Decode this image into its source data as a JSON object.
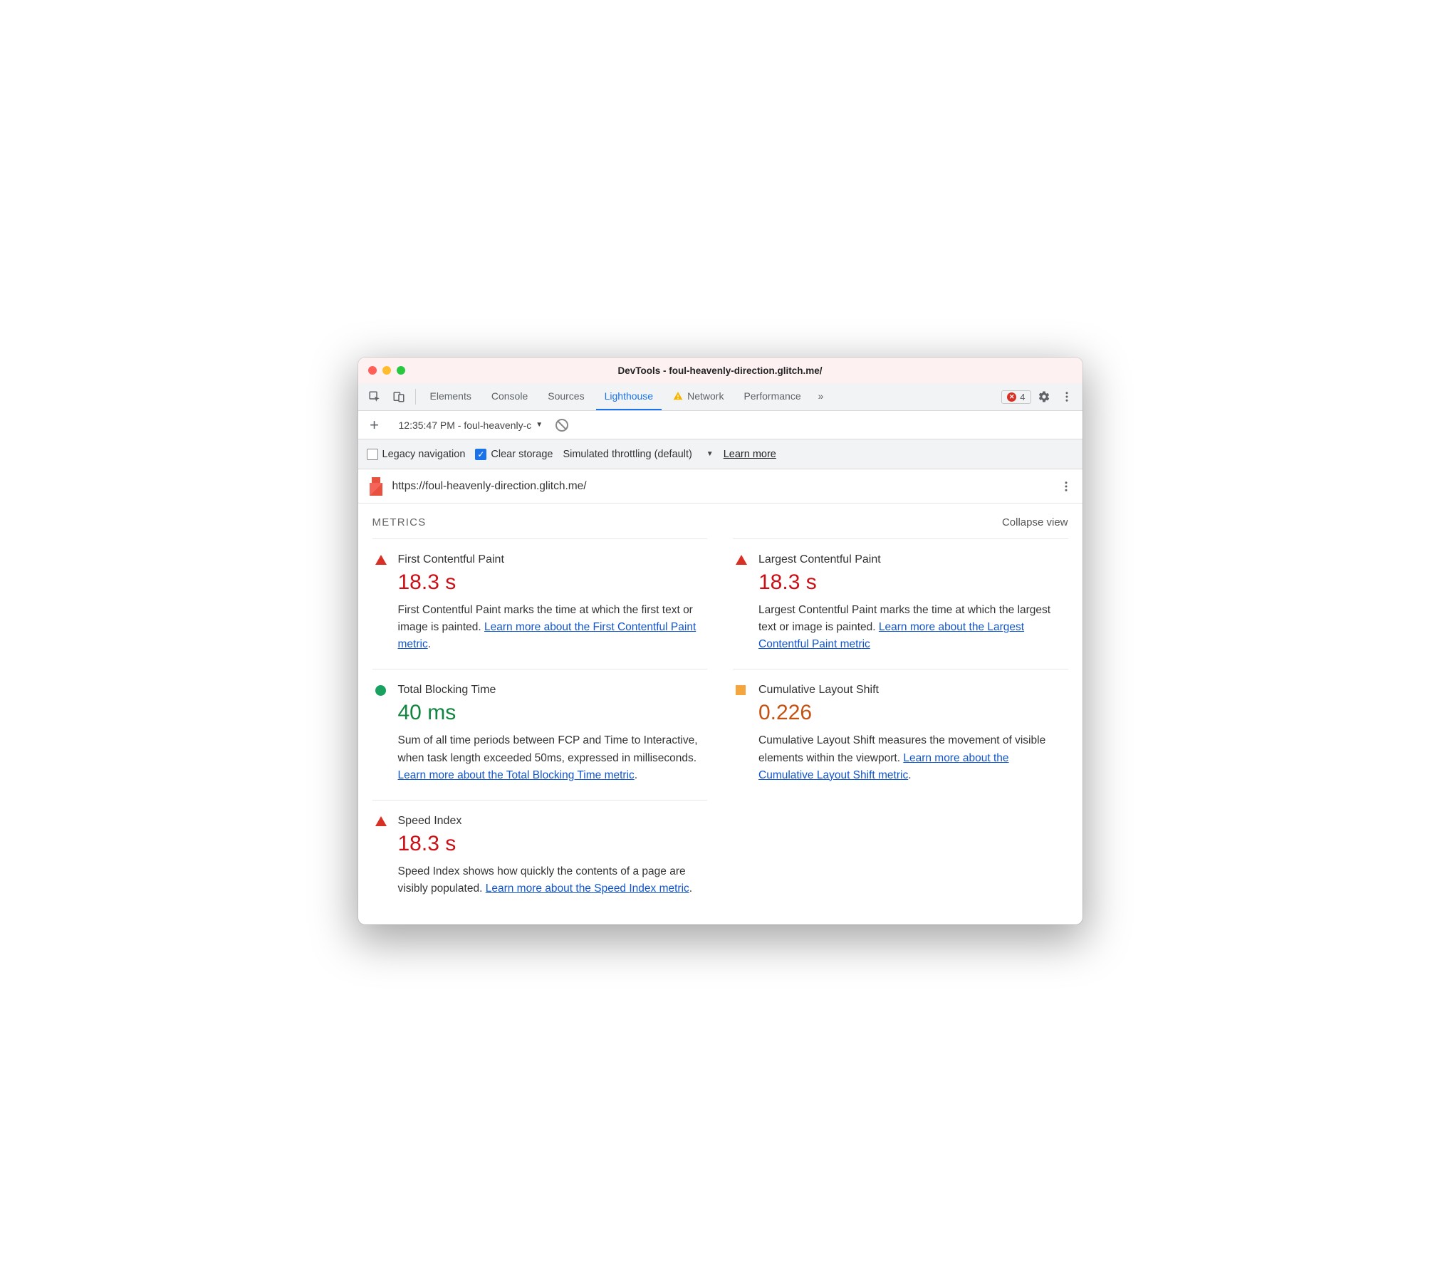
{
  "window": {
    "title": "DevTools - foul-heavenly-direction.glitch.me/"
  },
  "tabs": {
    "items": [
      "Elements",
      "Console",
      "Sources",
      "Lighthouse",
      "Network",
      "Performance"
    ],
    "active": "Lighthouse",
    "warn_tab_index": 4
  },
  "errors": {
    "count": "4"
  },
  "report_selector": {
    "label": "12:35:47 PM - foul-heavenly-c"
  },
  "options": {
    "legacy_label": "Legacy navigation",
    "legacy_checked": false,
    "clear_label": "Clear storage",
    "clear_checked": true,
    "throttling": "Simulated throttling (default)",
    "learn_more": "Learn more"
  },
  "url": "https://foul-heavenly-direction.glitch.me/",
  "metrics_header": {
    "label": "METRICS",
    "collapse": "Collapse view"
  },
  "metrics": {
    "fcp": {
      "name": "First Contentful Paint",
      "value": "18.3 s",
      "desc": "First Contentful Paint marks the time at which the first text or image is painted. ",
      "link": "Learn more about the First Contentful Paint metric"
    },
    "lcp": {
      "name": "Largest Contentful Paint",
      "value": "18.3 s",
      "desc": "Largest Contentful Paint marks the time at which the largest text or image is painted. ",
      "link": "Learn more about the Largest Contentful Paint metric"
    },
    "tbt": {
      "name": "Total Blocking Time",
      "value": "40 ms",
      "desc": "Sum of all time periods between FCP and Time to Interactive, when task length exceeded 50ms, expressed in milliseconds. ",
      "link": "Learn more about the Total Blocking Time metric"
    },
    "cls": {
      "name": "Cumulative Layout Shift",
      "value": "0.226",
      "desc": "Cumulative Layout Shift measures the movement of visible elements within the viewport. ",
      "link": "Learn more about the Cumulative Layout Shift metric"
    },
    "si": {
      "name": "Speed Index",
      "value": "18.3 s",
      "desc": "Speed Index shows how quickly the contents of a page are visibly populated. ",
      "link": "Learn more about the Speed Index metric"
    }
  }
}
